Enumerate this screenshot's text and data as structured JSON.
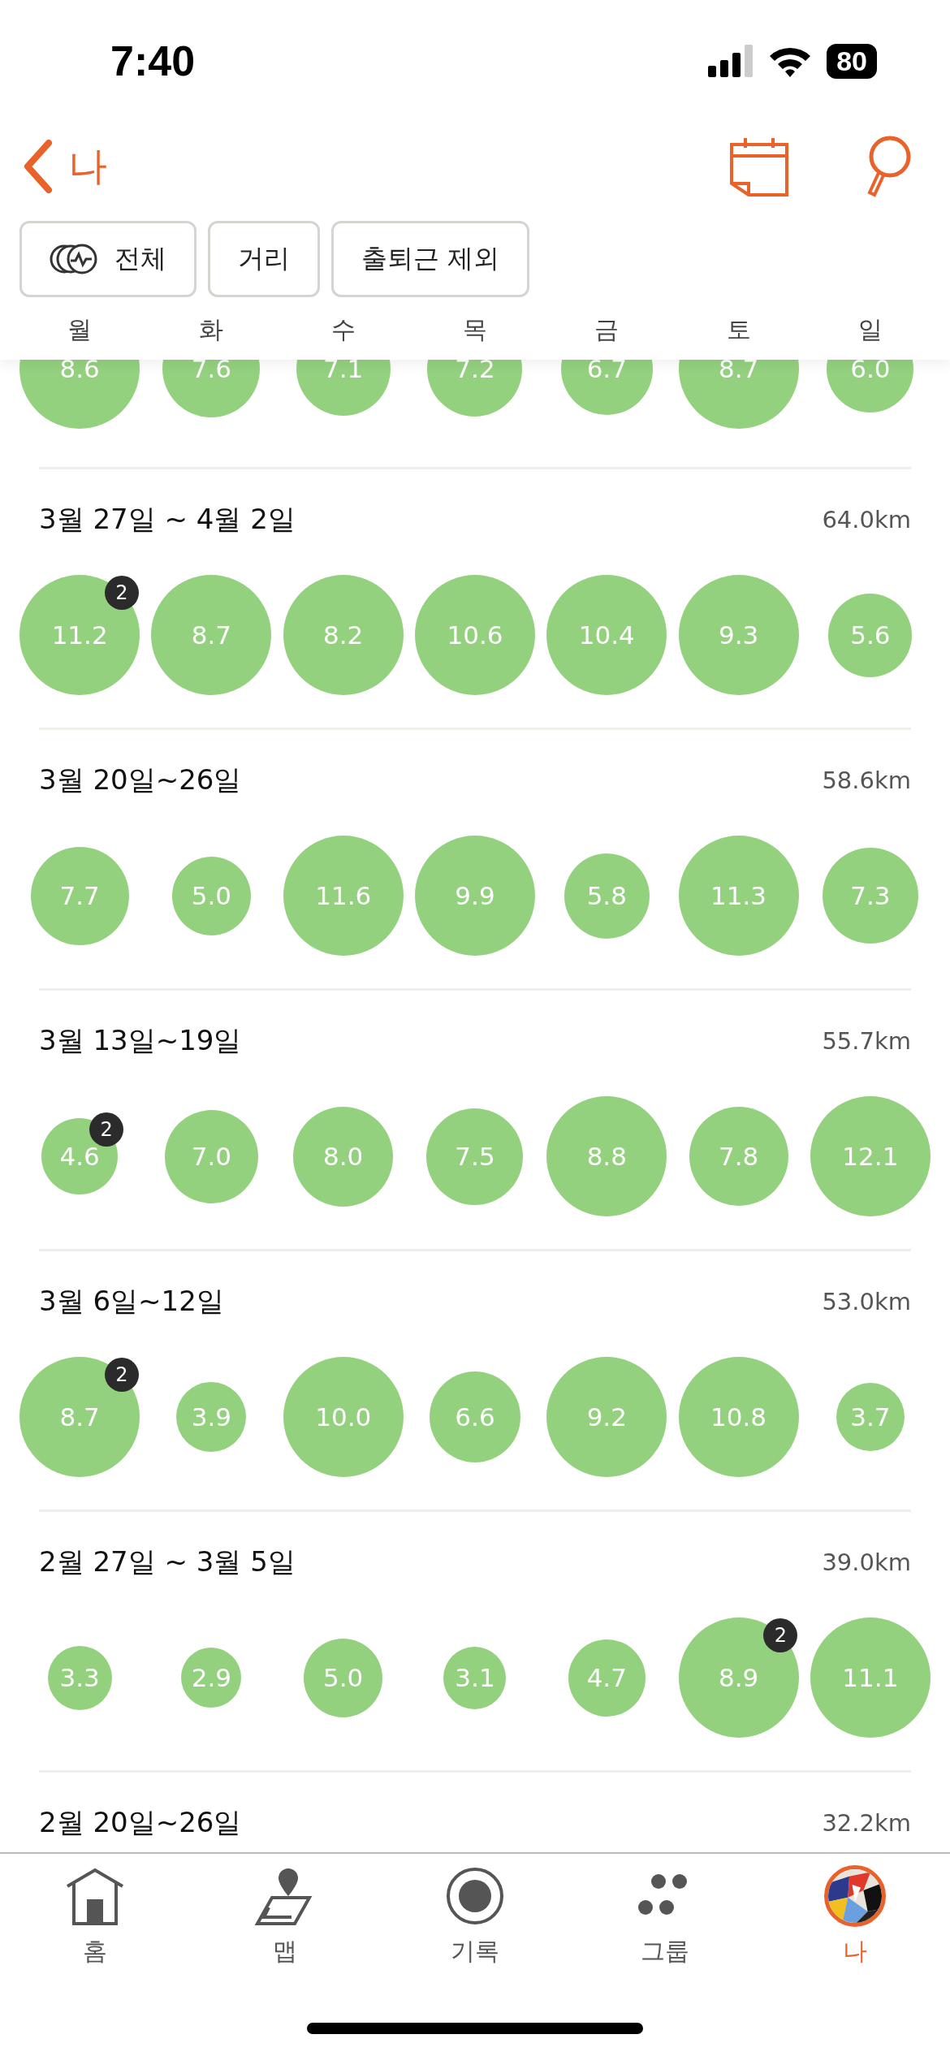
{
  "status_bar": {
    "time": "7:40",
    "battery": "80"
  },
  "header": {
    "back_label": "나"
  },
  "filters": [
    {
      "label": "전체",
      "icon": true
    },
    {
      "label": "거리",
      "icon": false
    },
    {
      "label": "출퇴근 제외",
      "icon": false
    }
  ],
  "weekdays": [
    "월",
    "화",
    "수",
    "목",
    "금",
    "토",
    "일"
  ],
  "partial_week": {
    "days": [
      {
        "value": "8.6"
      },
      {
        "value": "7.6"
      },
      {
        "value": "7.1"
      },
      {
        "value": "7.2"
      },
      {
        "value": "6.7"
      },
      {
        "value": "8.7"
      },
      {
        "value": "6.0"
      }
    ]
  },
  "weeks": [
    {
      "title": "3월 27일 ~ 4월 2일",
      "distance": "64.0km",
      "days": [
        {
          "value": "11.2",
          "badge": "2"
        },
        {
          "value": "8.7"
        },
        {
          "value": "8.2"
        },
        {
          "value": "10.6"
        },
        {
          "value": "10.4"
        },
        {
          "value": "9.3"
        },
        {
          "value": "5.6"
        }
      ]
    },
    {
      "title": "3월 20일~26일",
      "distance": "58.6km",
      "days": [
        {
          "value": "7.7"
        },
        {
          "value": "5.0"
        },
        {
          "value": "11.6"
        },
        {
          "value": "9.9"
        },
        {
          "value": "5.8"
        },
        {
          "value": "11.3"
        },
        {
          "value": "7.3"
        }
      ]
    },
    {
      "title": "3월 13일~19일",
      "distance": "55.7km",
      "days": [
        {
          "value": "4.6",
          "badge": "2"
        },
        {
          "value": "7.0"
        },
        {
          "value": "8.0"
        },
        {
          "value": "7.5"
        },
        {
          "value": "8.8"
        },
        {
          "value": "7.8"
        },
        {
          "value": "12.1"
        }
      ]
    },
    {
      "title": "3월 6일~12일",
      "distance": "53.0km",
      "days": [
        {
          "value": "8.7",
          "badge": "2"
        },
        {
          "value": "3.9"
        },
        {
          "value": "10.0"
        },
        {
          "value": "6.6"
        },
        {
          "value": "9.2"
        },
        {
          "value": "10.8"
        },
        {
          "value": "3.7"
        }
      ]
    },
    {
      "title": "2월 27일 ~ 3월 5일",
      "distance": "39.0km",
      "days": [
        {
          "value": "3.3"
        },
        {
          "value": "2.9"
        },
        {
          "value": "5.0"
        },
        {
          "value": "3.1"
        },
        {
          "value": "4.7"
        },
        {
          "value": "8.9",
          "badge": "2"
        },
        {
          "value": "11.1"
        }
      ]
    },
    {
      "title": "2월 20일~26일",
      "distance": "32.2km"
    }
  ],
  "tab_bar": [
    {
      "kind": "home",
      "label": "홈",
      "selected": false
    },
    {
      "kind": "map",
      "label": "맵",
      "selected": false
    },
    {
      "kind": "record",
      "label": "기록",
      "selected": false
    },
    {
      "kind": "groups",
      "label": "그룹",
      "selected": false
    },
    {
      "kind": "profile",
      "label": "나",
      "selected": true
    }
  ]
}
